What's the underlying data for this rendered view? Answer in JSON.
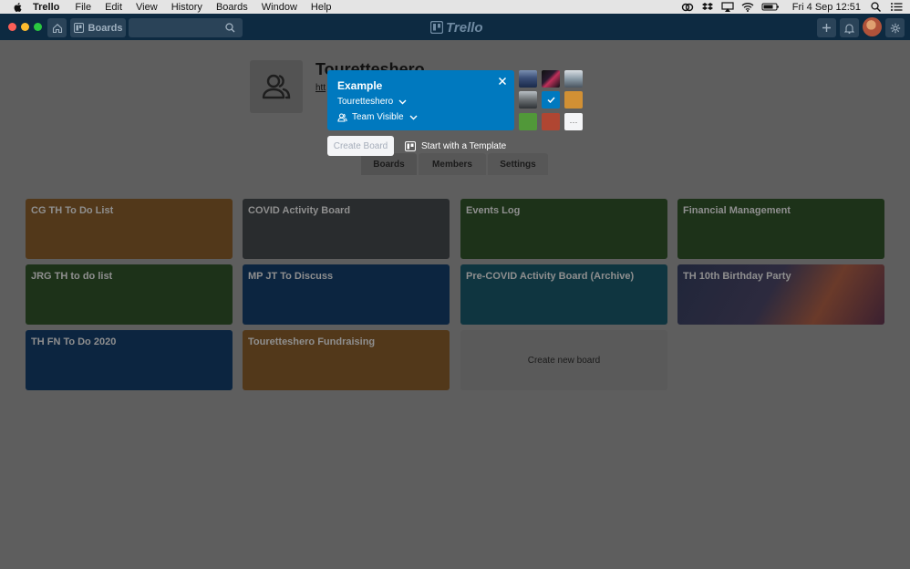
{
  "menubar": {
    "app_name": "Trello",
    "items": [
      "File",
      "Edit",
      "View",
      "History",
      "Boards",
      "Window",
      "Help"
    ],
    "clock": "Fri 4 Sep  12:51"
  },
  "header": {
    "boards_label": "Boards",
    "logo_text": "Trello"
  },
  "team": {
    "name": "Touretteshero",
    "link_text": "htt"
  },
  "popup": {
    "title": "Example",
    "team_select": "Touretteshero",
    "visibility": "Team Visible",
    "more_label": "···"
  },
  "actions": {
    "create_board": "Create Board",
    "template": "Start with a Template"
  },
  "tabs": [
    {
      "label": "Boards"
    },
    {
      "label": "Members"
    },
    {
      "label": "Settings"
    }
  ],
  "boards": [
    {
      "title": "CG TH To Do List",
      "color": "#52381a"
    },
    {
      "title": "COVID Activity Board",
      "color": "#292c2e"
    },
    {
      "title": "Events Log",
      "color": "#1d3219"
    },
    {
      "title": "Financial Management",
      "color": "#1d3219"
    },
    {
      "title": "JRG TH to do list",
      "color": "#1d3219"
    },
    {
      "title": "MP JT To Discuss",
      "color": "#0c2540"
    },
    {
      "title": "Pre-COVID Activity Board (Archive)",
      "color": "#0f3540"
    },
    {
      "title": "TH 10th Birthday Party",
      "color": "#2a2232"
    },
    {
      "title": "TH FN To Do 2020",
      "color": "#0c2540"
    },
    {
      "title": "Touretteshero Fundraising",
      "color": "#52381a"
    }
  ],
  "new_board_label": "Create new board",
  "colors": {
    "popup_blue": "#0079bf",
    "swatch_orange": "#d29034",
    "swatch_green": "#519839",
    "swatch_red": "#b04632"
  }
}
